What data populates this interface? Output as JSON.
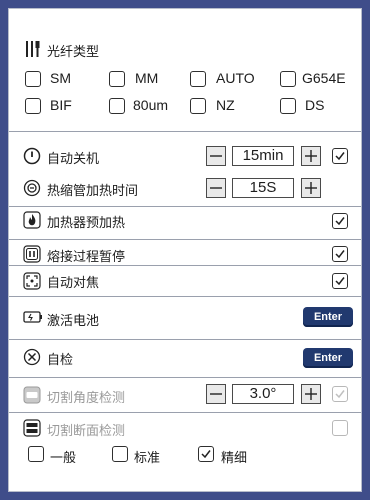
{
  "fiber_type": {
    "title": "光纤类型",
    "options": [
      {
        "label": "SM",
        "checked": false
      },
      {
        "label": "MM",
        "checked": false
      },
      {
        "label": "AUTO",
        "checked": false
      },
      {
        "label": "G654E",
        "checked": false
      },
      {
        "label": "BIF",
        "checked": false
      },
      {
        "label": "80um",
        "checked": false
      },
      {
        "label": "NZ",
        "checked": false
      },
      {
        "label": "DS",
        "checked": false
      }
    ]
  },
  "settings": {
    "auto_shutdown": {
      "label": "自动关机",
      "value": "15min",
      "checked": true,
      "icon": "power-icon"
    },
    "heat_shrink_time": {
      "label": "热缩管加热时间",
      "value": "15S",
      "icon": "heat-tube-icon"
    },
    "preheat": {
      "label": "加热器预加热",
      "checked": true,
      "icon": "flame-icon"
    },
    "pause_during_splice": {
      "label": "熔接过程暂停",
      "checked": true,
      "icon": "pause-icon"
    },
    "auto_focus": {
      "label": "自动对焦",
      "checked": true,
      "icon": "focus-icon"
    },
    "activate_battery": {
      "label": "激活电池",
      "button": "Enter",
      "icon": "battery-icon"
    },
    "self_check": {
      "label": "自检",
      "button": "Enter",
      "icon": "tools-icon"
    },
    "cleave_angle_check": {
      "label": "切割角度检测",
      "value": "3.0°",
      "checked": true,
      "disabled": true,
      "icon": "cleave-angle-icon"
    },
    "cleave_face_check": {
      "label": "切割断面检测",
      "checked": false,
      "disabled": true,
      "icon": "cleave-face-icon"
    }
  },
  "precision": {
    "options": [
      {
        "label": "一般",
        "checked": false
      },
      {
        "label": "标准",
        "checked": false
      },
      {
        "label": "精细",
        "checked": true
      }
    ]
  },
  "colors": {
    "background": "#3f4d8a",
    "button": "#21396f",
    "divider": "#9aa0ad",
    "disabled": "#9a9a9a"
  }
}
